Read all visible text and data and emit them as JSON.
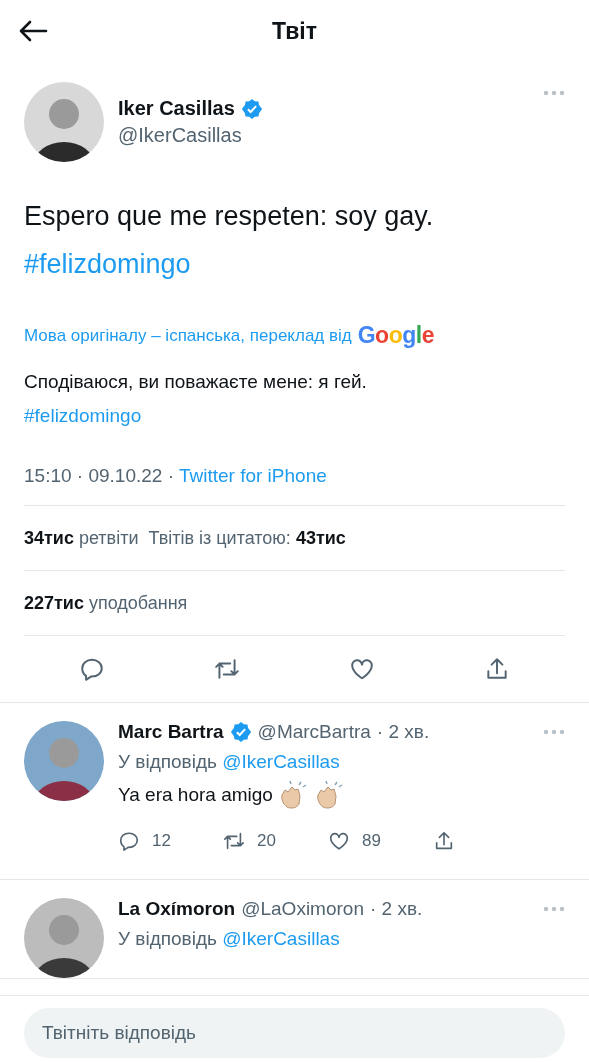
{
  "header": {
    "title": "Твіт"
  },
  "tweet": {
    "author": {
      "name": "Iker Casillas",
      "handle": "@IkerCasillas",
      "verified": true
    },
    "text": "Espero que me respeten: soy gay.",
    "hashtag": "#felizdomingo",
    "translation": {
      "label": "Мова оригіналу – іспанська, переклад від",
      "provider": "Google",
      "text": "Сподіваюся, ви поважаєте мене: я гей.",
      "hashtag": "#felizdomingo"
    },
    "time": "15:10 · 09.10.22 ·",
    "source": "Twitter for iPhone",
    "retweets": {
      "value": "34тис",
      "label": "ретвіти"
    },
    "quotes": {
      "label": "Твітів із цитатою:",
      "value": "43тис"
    },
    "likes": {
      "value": "227тис",
      "label": "уподобання"
    }
  },
  "replies": [
    {
      "name": "Marc Bartra",
      "verified": true,
      "handle": "@MarcBartra",
      "time": "· 2 хв.",
      "reply_to_label": "У відповідь",
      "reply_to": "@IkerCasillas",
      "text": "Ya era hora amigo",
      "reactions": [
        {
          "kind": "clap"
        },
        {
          "kind": "clap"
        }
      ],
      "counts": {
        "replies": "12",
        "retweets": "20",
        "likes": "89"
      }
    },
    {
      "name": "La Oxímoron",
      "verified": false,
      "handle": "@LaOximoron",
      "time": "· 2 хв.",
      "reply_to_label": "У відповідь",
      "reply_to": "@IkerCasillas"
    }
  ],
  "reply_bar": {
    "placeholder": "Твітніть відповідь"
  }
}
